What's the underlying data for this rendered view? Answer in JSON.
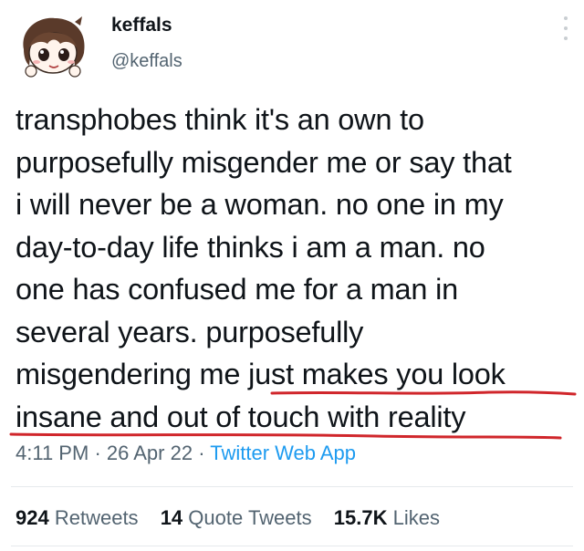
{
  "author": {
    "display_name": "keffals",
    "handle": "@keffals",
    "avatar_icon": "anime-avatar-icon"
  },
  "tweet": {
    "lines": [
      "transphobes think it's an own to",
      "purposefully misgender me or say that",
      "i will never be a woman. no one in my",
      "day-to-day life thinks i am a man. no",
      "one has confused me for a man in",
      "several years. purposefully",
      "misgendering me just makes you look",
      "insane and out of touch with reality"
    ]
  },
  "meta": {
    "time": "4:11 PM",
    "separator": "·",
    "date": "26 Apr 22",
    "app": "Twitter Web App"
  },
  "stats": {
    "retweets_count": "924",
    "retweets_label": "Retweets",
    "quotes_count": "14",
    "quotes_label": "Quote Tweets",
    "likes_count": "15.7K",
    "likes_label": "Likes"
  },
  "colors": {
    "accent": "#1d9bf0",
    "annotation_underline": "#d0262b",
    "secondary_text": "#536471"
  }
}
